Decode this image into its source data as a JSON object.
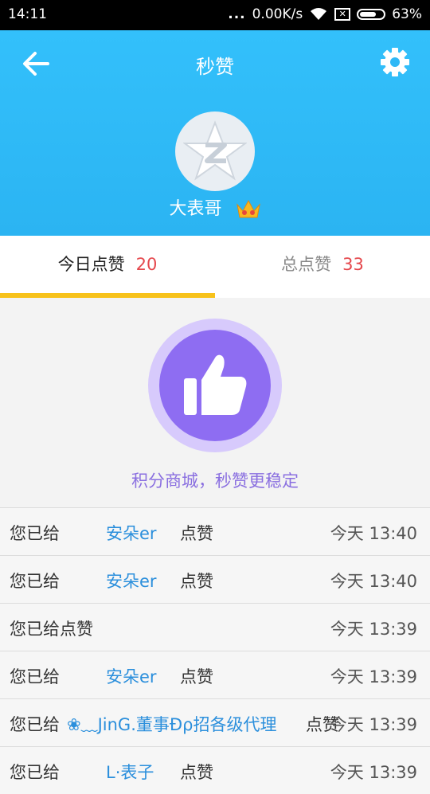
{
  "status_bar": {
    "time": "14:11",
    "signal_dots": "...",
    "speed": "0.00K/s",
    "battery": "63%"
  },
  "header": {
    "title": "秒赞",
    "username": "大表哥"
  },
  "tabs": [
    {
      "label": "今日点赞",
      "count": "20"
    },
    {
      "label": "总点赞",
      "count": "33"
    }
  ],
  "promo_text": "积分商城，秒赞更稳定",
  "records": [
    {
      "prefix": "您已给",
      "name": "安朵er",
      "suffix": "点赞",
      "time": "今天 13:40"
    },
    {
      "prefix": "您已给",
      "name": "安朵er",
      "suffix": "点赞",
      "time": "今天 13:40"
    },
    {
      "prefix": "您已给点赞",
      "name": "",
      "suffix": "",
      "time": "今天 13:39"
    },
    {
      "prefix": "您已给",
      "name": "安朵er",
      "suffix": "点赞",
      "time": "今天 13:39"
    },
    {
      "prefix": "您已给",
      "name": "❀﹏JinG.董事Ɖρ招各级代理",
      "suffix": "点赞",
      "time": "今天 13:39"
    },
    {
      "prefix": "您已给",
      "name": "L·表子",
      "suffix": "点赞",
      "time": "今天 13:39"
    }
  ],
  "colors": {
    "header_bg": "#33c0fb",
    "tab_indicator": "#f7c21b",
    "count_red": "#e5484d",
    "like_purple": "#8e6df2",
    "name_blue": "#2b8fdc"
  },
  "icons": [
    "back-arrow-icon",
    "gear-icon",
    "qq-star-avatar-icon",
    "crown-vip-icon",
    "thumbs-up-icon",
    "wifi-icon"
  ]
}
